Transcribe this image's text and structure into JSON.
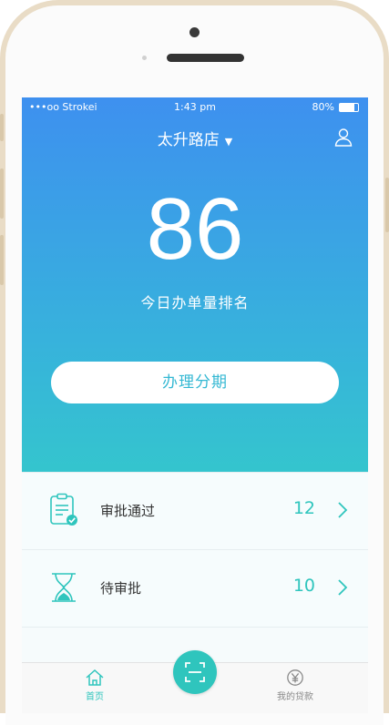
{
  "status_bar": {
    "carrier": "•••oo Strokei",
    "time": "1:43 pm",
    "battery_pct": "80%"
  },
  "header": {
    "store_name": "太升路店",
    "dropdown_caret": "▼",
    "user_icon": "user-icon"
  },
  "hero": {
    "rank_value": "86",
    "rank_label": "今日办单量排名"
  },
  "apply_button": {
    "label": "办理分期"
  },
  "stats": [
    {
      "label": "审批通过",
      "count": "12",
      "icon": "clipboard-check-icon"
    },
    {
      "label": "待审批",
      "count": "10",
      "icon": "hourglass-icon"
    }
  ],
  "tabbar": {
    "home_label": "首页",
    "loans_label": "我的贷款",
    "scan_icon": "scan-icon"
  },
  "colors": {
    "gradient_top": "#3e8ff0",
    "gradient_bottom": "#33cfc6",
    "accent": "#2fc5bd",
    "frame": "#e9dcc6"
  }
}
